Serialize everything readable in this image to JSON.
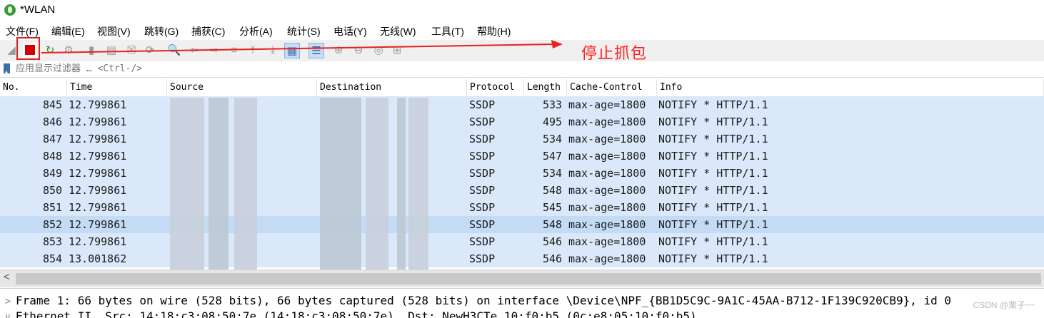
{
  "window": {
    "title": "*WLAN"
  },
  "menu": [
    "文件(F)",
    "编辑(E)",
    "视图(V)",
    "跳转(G)",
    "捕获(C)",
    "分析(A)",
    "统计(S)",
    "电话(Y)",
    "无线(W)",
    "工具(T)",
    "帮助(H)"
  ],
  "toolbar": {
    "icons": [
      "shark-fin-start-icon",
      "stop-capture-icon",
      "restart-capture-icon",
      "capture-options-icon",
      "open-file-icon",
      "save-file-icon",
      "close-file-icon",
      "reload-file-icon",
      "find-packet-icon",
      "go-back-icon",
      "go-forward-icon",
      "go-to-packet-icon",
      "go-first-icon",
      "go-last-icon",
      "auto-scroll-icon",
      "colorize-icon",
      "zoom-in-icon",
      "zoom-out-icon",
      "zoom-normal-icon",
      "resize-columns-icon"
    ]
  },
  "filter": {
    "placeholder": "应用显示过滤器 … <Ctrl-/>"
  },
  "columns": [
    "No.",
    "Time",
    "Source",
    "Destination",
    "Protocol",
    "Length",
    "Cache-Control",
    "Info"
  ],
  "packets": [
    {
      "no": "845",
      "time": "12.799861",
      "protocol": "SSDP",
      "length": "533",
      "cache": "max-age=1800",
      "info": "NOTIFY * HTTP/1.1"
    },
    {
      "no": "846",
      "time": "12.799861",
      "protocol": "SSDP",
      "length": "495",
      "cache": "max-age=1800",
      "info": "NOTIFY * HTTP/1.1"
    },
    {
      "no": "847",
      "time": "12.799861",
      "protocol": "SSDP",
      "length": "534",
      "cache": "max-age=1800",
      "info": "NOTIFY * HTTP/1.1"
    },
    {
      "no": "848",
      "time": "12.799861",
      "protocol": "SSDP",
      "length": "547",
      "cache": "max-age=1800",
      "info": "NOTIFY * HTTP/1.1"
    },
    {
      "no": "849",
      "time": "12.799861",
      "protocol": "SSDP",
      "length": "534",
      "cache": "max-age=1800",
      "info": "NOTIFY * HTTP/1.1"
    },
    {
      "no": "850",
      "time": "12.799861",
      "protocol": "SSDP",
      "length": "548",
      "cache": "max-age=1800",
      "info": "NOTIFY * HTTP/1.1"
    },
    {
      "no": "851",
      "time": "12.799861",
      "protocol": "SSDP",
      "length": "545",
      "cache": "max-age=1800",
      "info": "NOTIFY * HTTP/1.1"
    },
    {
      "no": "852",
      "time": "12.799861",
      "protocol": "SSDP",
      "length": "548",
      "cache": "max-age=1800",
      "info": "NOTIFY * HTTP/1.1"
    },
    {
      "no": "853",
      "time": "12.799861",
      "protocol": "SSDP",
      "length": "546",
      "cache": "max-age=1800",
      "info": "NOTIFY * HTTP/1.1"
    },
    {
      "no": "854",
      "time": "13.001862",
      "protocol": "SSDP",
      "length": "546",
      "cache": "max-age=1800",
      "info": "NOTIFY * HTTP/1.1"
    }
  ],
  "selected_packet": "852",
  "details": [
    "Frame 1: 66 bytes on wire (528 bits), 66 bytes captured (528 bits) on interface \\Device\\NPF_{BB1D5C9C-9A1C-45AA-B712-1F139C920CB9}, id 0",
    "Ethernet II, Src: 14:18:c3:08:50:7e (14:18:c3:08:50:7e), Dst: NewH3CTe_10:f0:b5 (0c:e8:05:10:f0:b5)"
  ],
  "annotation": {
    "text": "停止抓包",
    "color": "#ff2020"
  },
  "watermark": "CSDN @栗子~~",
  "colors": {
    "row_bg": "#dae8fa",
    "row_selected": "#c4dbf6"
  }
}
